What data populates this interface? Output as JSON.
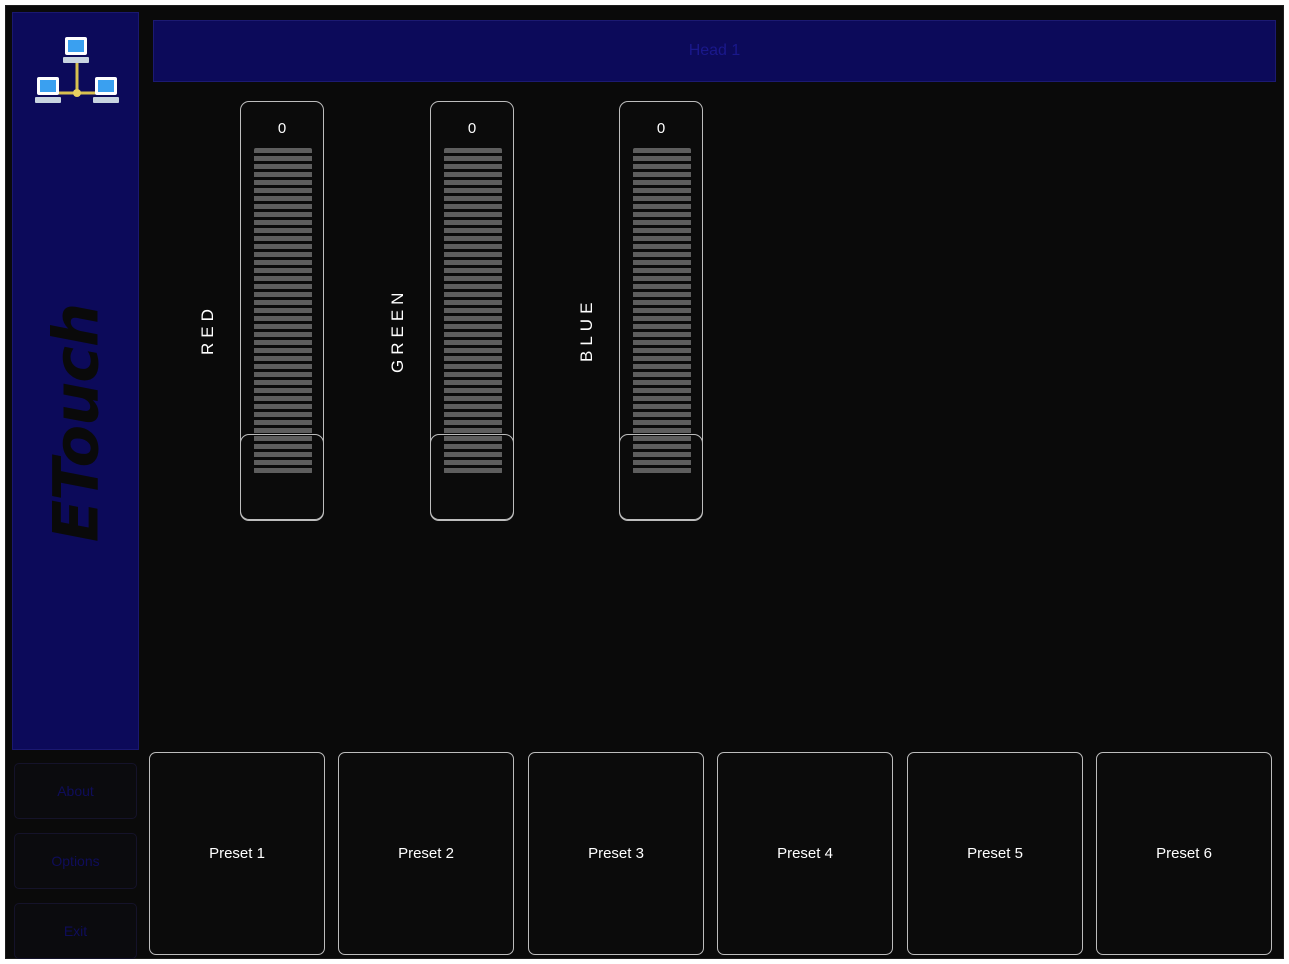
{
  "app": {
    "brand": "ETouch",
    "title": "Head 1"
  },
  "sidebar": {
    "logo_icon": "network-computers-icon",
    "buttons": [
      {
        "label": "About"
      },
      {
        "label": "Options"
      },
      {
        "label": "Exit"
      }
    ]
  },
  "faders": [
    {
      "label": "RED",
      "value": "0",
      "level": 0
    },
    {
      "label": "GREEN",
      "value": "0",
      "level": 0
    },
    {
      "label": "BLUE",
      "value": "0",
      "level": 0
    }
  ],
  "presets": [
    {
      "label": "Preset 1"
    },
    {
      "label": "Preset 2"
    },
    {
      "label": "Preset 3"
    },
    {
      "label": "Preset 4"
    },
    {
      "label": "Preset 5"
    },
    {
      "label": "Preset 6"
    }
  ],
  "colors": {
    "panel_background": "#0a0a0a",
    "accent_navy": "#0c0a5a",
    "outline": "#bdbdbd"
  }
}
